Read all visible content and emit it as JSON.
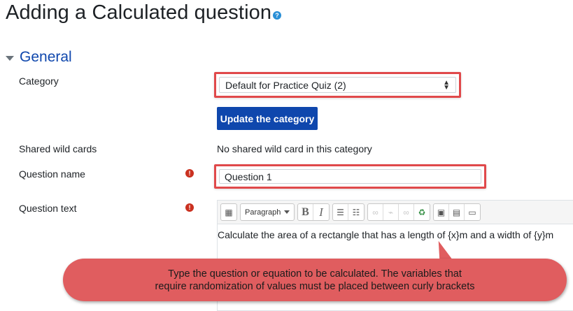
{
  "page": {
    "title": "Adding a Calculated question"
  },
  "section": {
    "title": "General"
  },
  "fields": {
    "category": {
      "label": "Category",
      "value": "Default for Practice Quiz (2)"
    },
    "update_button": "Update the category",
    "wildcards": {
      "label": "Shared wild cards",
      "value": "No shared wild card in this category"
    },
    "question_name": {
      "label": "Question name",
      "value": "Question 1"
    },
    "question_text": {
      "label": "Question text",
      "content": "Calculate the area of a rectangle that has a length of {x}m and a width of {y}m"
    }
  },
  "editor": {
    "paragraph_label": "Paragraph",
    "bold": "B",
    "italic": "I"
  },
  "callout": {
    "line1": "Type the question or equation to be calculated. The variables that",
    "line2": "require randomization of values must be placed between curly brackets"
  },
  "colors": {
    "primary": "#0f47ad",
    "highlight": "#e0494b",
    "required": "#ca3120",
    "callout": "#e05d5f"
  }
}
